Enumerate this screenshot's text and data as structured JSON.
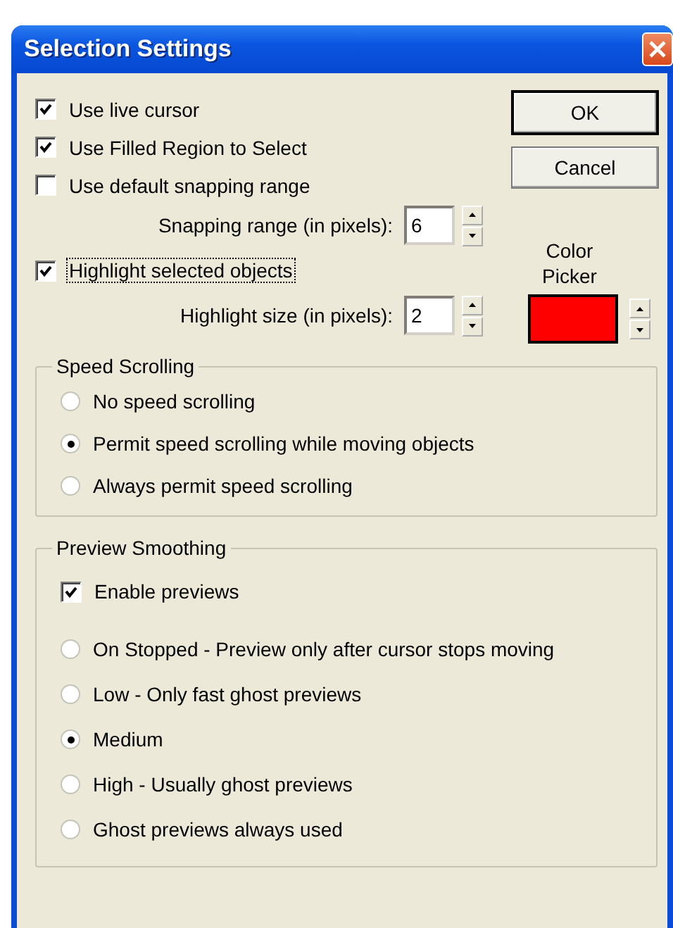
{
  "window": {
    "title": "Selection Settings"
  },
  "options": [
    {
      "label": "Use live cursor",
      "checked": true
    },
    {
      "label": "Use Filled Region to Select",
      "checked": true
    },
    {
      "label": "Use default snapping range",
      "checked": false
    }
  ],
  "snapping": {
    "label": "Snapping range (in pixels):",
    "value": "6"
  },
  "highlight": {
    "label": "Highlight selected objects",
    "checked": true,
    "focused": true
  },
  "highlight_size": {
    "label": "Highlight size (in pixels):",
    "value": "2"
  },
  "buttons": [
    {
      "label": "OK",
      "default": true
    },
    {
      "label": "Cancel",
      "default": false
    }
  ],
  "color_picker": {
    "label": "Color Picker",
    "color": "#ff0000"
  },
  "speed_scrolling": {
    "title": "Speed Scrolling",
    "options": [
      {
        "label": "No speed scrolling",
        "selected": false
      },
      {
        "label": "Permit speed scrolling while moving objects",
        "selected": true
      },
      {
        "label": "Always permit speed scrolling",
        "selected": false
      }
    ]
  },
  "preview_smoothing": {
    "title": "Preview Smoothing",
    "enable": {
      "label": "Enable previews",
      "checked": true
    },
    "options": [
      {
        "label": "On Stopped - Preview only after cursor stops moving",
        "selected": false
      },
      {
        "label": "Low - Only fast ghost previews",
        "selected": false
      },
      {
        "label": "Medium",
        "selected": true
      },
      {
        "label": "High - Usually ghost previews",
        "selected": false
      },
      {
        "label": "Ghost previews always used",
        "selected": false
      }
    ]
  }
}
